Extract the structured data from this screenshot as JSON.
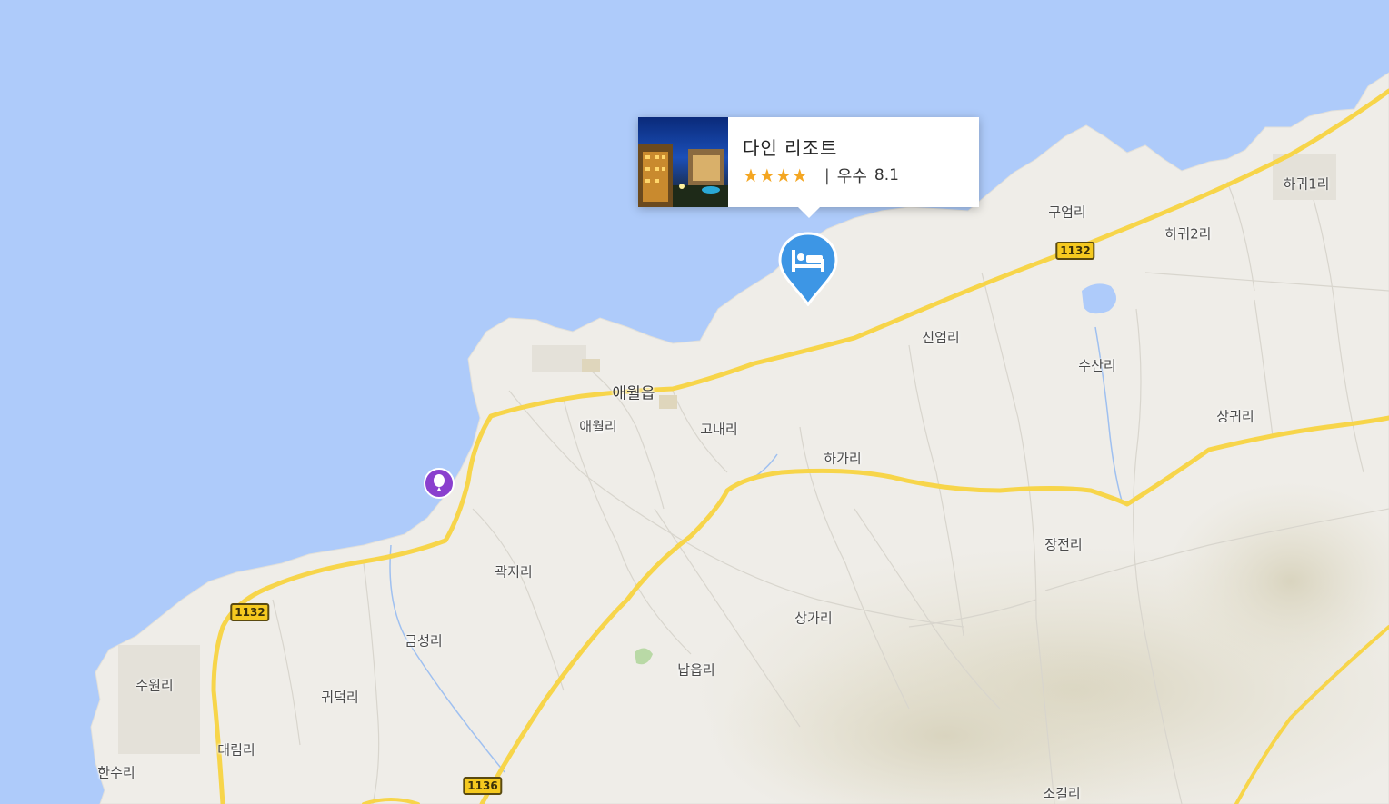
{
  "map": {
    "colors": {
      "water": "#aecbfa",
      "land": "#efede8",
      "highway": "#f7d54a",
      "hotel_marker": "#3d96e5",
      "poi_marker": "#8a3fce",
      "star": "#f4a622"
    },
    "places": {
      "aewol_eup": "애월읍",
      "aewol_ri": "애월리",
      "gonae_ri": "고내리",
      "haga_ri": "하가리",
      "sineom_ri": "신엄리",
      "gueom_ri": "구엄리",
      "hagwi2_ri": "하귀2리",
      "hagwi1_ri": "하귀1리",
      "susan_ri": "수산리",
      "sanggwi_ri": "상귀리",
      "jangjeon_ri": "장전리",
      "gwakji_ri": "곽지리",
      "geumseong_ri": "금성리",
      "sangga_ri": "상가리",
      "napeup_ri": "납읍리",
      "suwon_ri": "수원리",
      "gwideok_ri": "귀덕리",
      "daerim_ri": "대림리",
      "hansu_ri": "한수리",
      "sogil_ri": "소길리"
    },
    "road_shields": {
      "r1132_east": "1132",
      "r1132_west": "1132",
      "r1136": "1136"
    }
  },
  "popup": {
    "name": "다인 리조트",
    "stars": "★★★★",
    "separator": "|",
    "rating_label": "우수",
    "rating_score": "8.1"
  },
  "markers": {
    "hotel_icon": "hotel-bed-icon",
    "poi_icon": "balloon-icon"
  }
}
